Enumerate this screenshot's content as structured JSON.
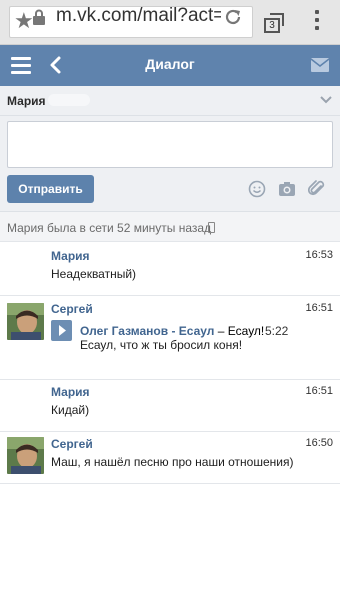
{
  "browser": {
    "url": "m.vk.com/mail?act=s",
    "tab_count": "3"
  },
  "header": {
    "title": "Диалог"
  },
  "recipient": {
    "name": "Мария"
  },
  "compose": {
    "placeholder": "",
    "send_label": "Отправить"
  },
  "status": {
    "text": "Мария была в сети 52 минуты назад"
  },
  "messages": [
    {
      "author": "Мария",
      "time": "16:53",
      "text": "Неадекватный)"
    },
    {
      "author": "Сергей",
      "time": "16:51",
      "audio": {
        "artist": "Олег Газманов - Есаул",
        "dash": " – ",
        "title_part": "Есаул!",
        "duration": "5:22"
      },
      "text": "Есаул, что ж ты бросил коня!"
    },
    {
      "author": "Мария",
      "time": "16:51",
      "text": "Кидай)"
    },
    {
      "author": "Сергей",
      "time": "16:50",
      "text": "Маш, я нашёл песню про наши отношения)"
    }
  ],
  "colors": {
    "header_bg": "#5f83ad",
    "link": "#41658f",
    "send_button": "#5d82ac"
  },
  "icons": [
    "star-icon",
    "lock-icon",
    "reload-icon",
    "tabs-icon",
    "menu-icon",
    "burger-icon",
    "back-icon",
    "mail-icon",
    "chevron-down-icon",
    "smile-icon",
    "camera-icon",
    "paperclip-icon",
    "phone-icon",
    "play-icon"
  ]
}
